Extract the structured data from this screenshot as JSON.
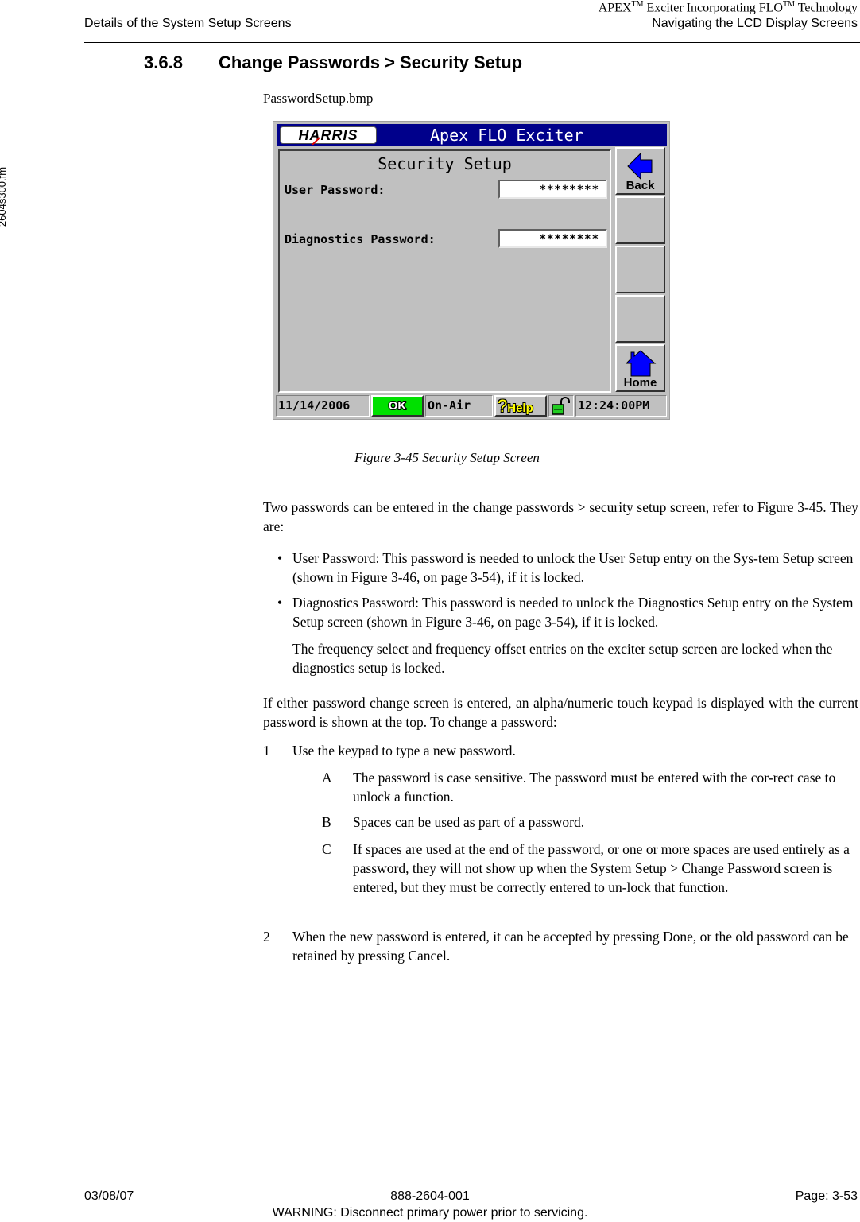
{
  "side_label": "2604s300.fm",
  "header": {
    "left": "Details of the System Setup Screens",
    "right_line1_parts": [
      "APEX",
      "TM",
      " Exciter Incorporating FLO",
      "TM",
      " Technology"
    ],
    "right_line2": "Navigating the LCD Display Screens"
  },
  "section": {
    "number": "3.6.8",
    "title": "Change Passwords > Security Setup"
  },
  "bitmap_name": "PasswordSetup.bmp",
  "lcd": {
    "brand": "HARRIS",
    "app_title": "Apex FLO Exciter",
    "panel_title": "Security Setup",
    "fields": [
      {
        "label": "User Password:",
        "value": "********"
      },
      {
        "label": "Diagnostics Password:",
        "value": "********"
      }
    ],
    "side_buttons": [
      {
        "label": "Back",
        "icon": "back-arrow-icon"
      },
      {
        "label": ""
      },
      {
        "label": ""
      },
      {
        "label": ""
      },
      {
        "label": "Home",
        "icon": "home-icon"
      }
    ],
    "status_bar": {
      "date": "11/14/2006",
      "status": "OK",
      "mode": "On-Air",
      "help": "Help",
      "lock_icon": "unlocked-padlock-icon",
      "time": "12:24:00PM"
    },
    "colors": {
      "title_bar": "#00008b",
      "ok": "#00e000",
      "icons": "#0000ff",
      "help_text": "#ffff00",
      "lock": "#22cc22"
    }
  },
  "figure_caption": "Figure 3-45  Security Setup Screen",
  "body": {
    "intro": "Two passwords can be entered in the change passwords > security setup screen, refer to Figure 3-45. They are:",
    "bullets": [
      "User Password: This password is needed to unlock the User Setup entry on the Sys-tem Setup screen (shown in Figure 3-46, on page 3-54), if it is locked.",
      "Diagnostics Password: This password is needed to unlock the Diagnostics Setup entry on the System Setup screen (shown in Figure 3-46, on page 3-54), if it is locked."
    ],
    "bullet_note": "The frequency select and frequency offset entries on the exciter setup screen are locked when the diagnostics setup is locked.",
    "para2": "If either password change screen is entered, an alpha/numeric touch keypad is displayed with the current password is shown at the top. To change a password:",
    "steps": [
      {
        "num": "1",
        "text": "Use the keypad to type a new password."
      },
      {
        "num": "2",
        "text": "When the new password is entered, it can be accepted by pressing Done, or the old password can be retained by pressing Cancel."
      }
    ],
    "substeps": [
      {
        "letter": "A",
        "text": "The password is case sensitive. The password must be entered with the cor-rect case to unlock a function."
      },
      {
        "letter": "B",
        "text": "Spaces can be used as part of a password."
      },
      {
        "letter": "C",
        "text": "If spaces are used at the end of the password, or one or more spaces are used entirely as a password, they will not show up when the System Setup > Change Password screen is entered, but they must be correctly entered to un-lock that function."
      }
    ]
  },
  "footer": {
    "date": "03/08/07",
    "doc_number": "888-2604-001",
    "page": "Page: 3-53",
    "warning": "WARNING: Disconnect primary power prior to servicing."
  }
}
